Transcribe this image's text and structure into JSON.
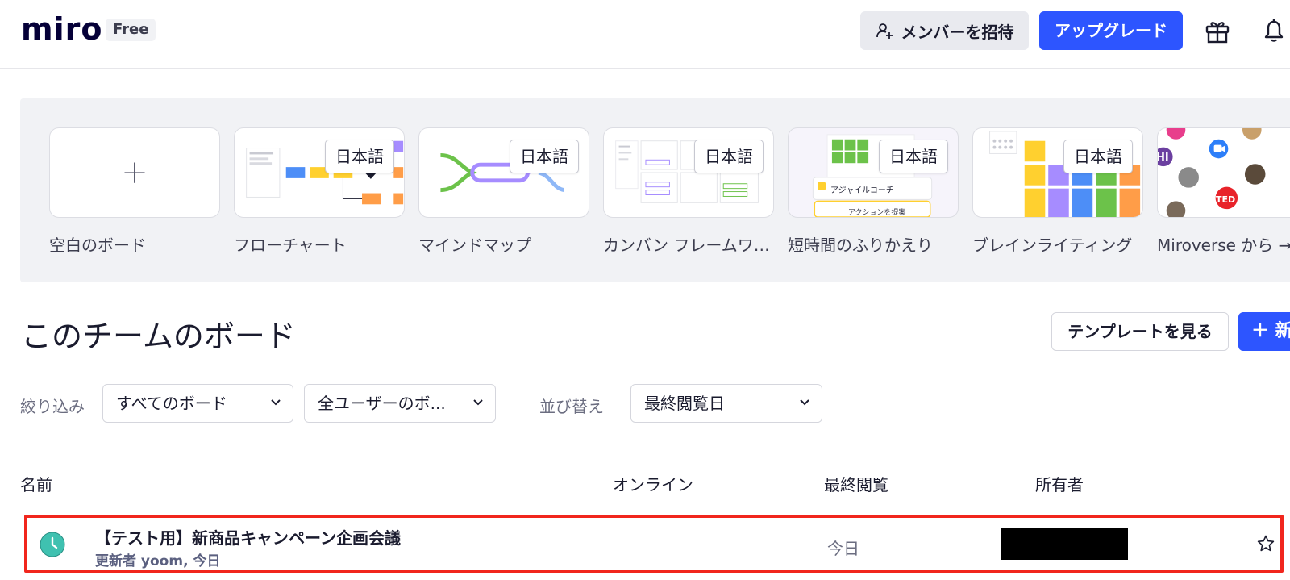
{
  "header": {
    "logo": "miro",
    "plan_badge": "Free",
    "invite_label": "メンバーを招待",
    "upgrade_label": "アップグレード",
    "accent_color": "#2d55ff"
  },
  "templates": {
    "items": [
      {
        "label": "空白のボード",
        "tag": "",
        "icon": "plus-icon"
      },
      {
        "label": "フローチャート",
        "tag": "日本語"
      },
      {
        "label": "マインドマップ",
        "tag": "日本語"
      },
      {
        "label": "カンバン フレームワーク",
        "tag": "日本語"
      },
      {
        "label": "短時間のふりかえり",
        "tag": "日本語",
        "thumb_texts": [
          "アジャイルコーチ",
          "アクションを提案"
        ]
      },
      {
        "label": "ブレインライティング",
        "tag": "日本語"
      },
      {
        "label": "Miroverse から →",
        "tag": "",
        "thumb_texts": [
          "HI",
          "TED"
        ]
      }
    ]
  },
  "section": {
    "title": "このチームのボード",
    "view_templates_label": "テンプレートを見る",
    "new_label": "＋ 新"
  },
  "filters": {
    "filter_label": "絞り込み",
    "board_filter": "すべてのボード",
    "owner_filter": "全ユーザーのボ...",
    "sort_label": "並び替え",
    "sort_value": "最終閲覧日"
  },
  "table": {
    "columns": [
      "名前",
      "オンライン",
      "最終閲覧",
      "所有者"
    ],
    "rows": [
      {
        "name": "【テスト用】新商品キャンペーン企画会議",
        "meta": "更新者 yoom, 今日",
        "last_viewed": "今日",
        "owner": "",
        "icon": "clock-icon",
        "highlight_color": "#f1261d"
      }
    ]
  }
}
